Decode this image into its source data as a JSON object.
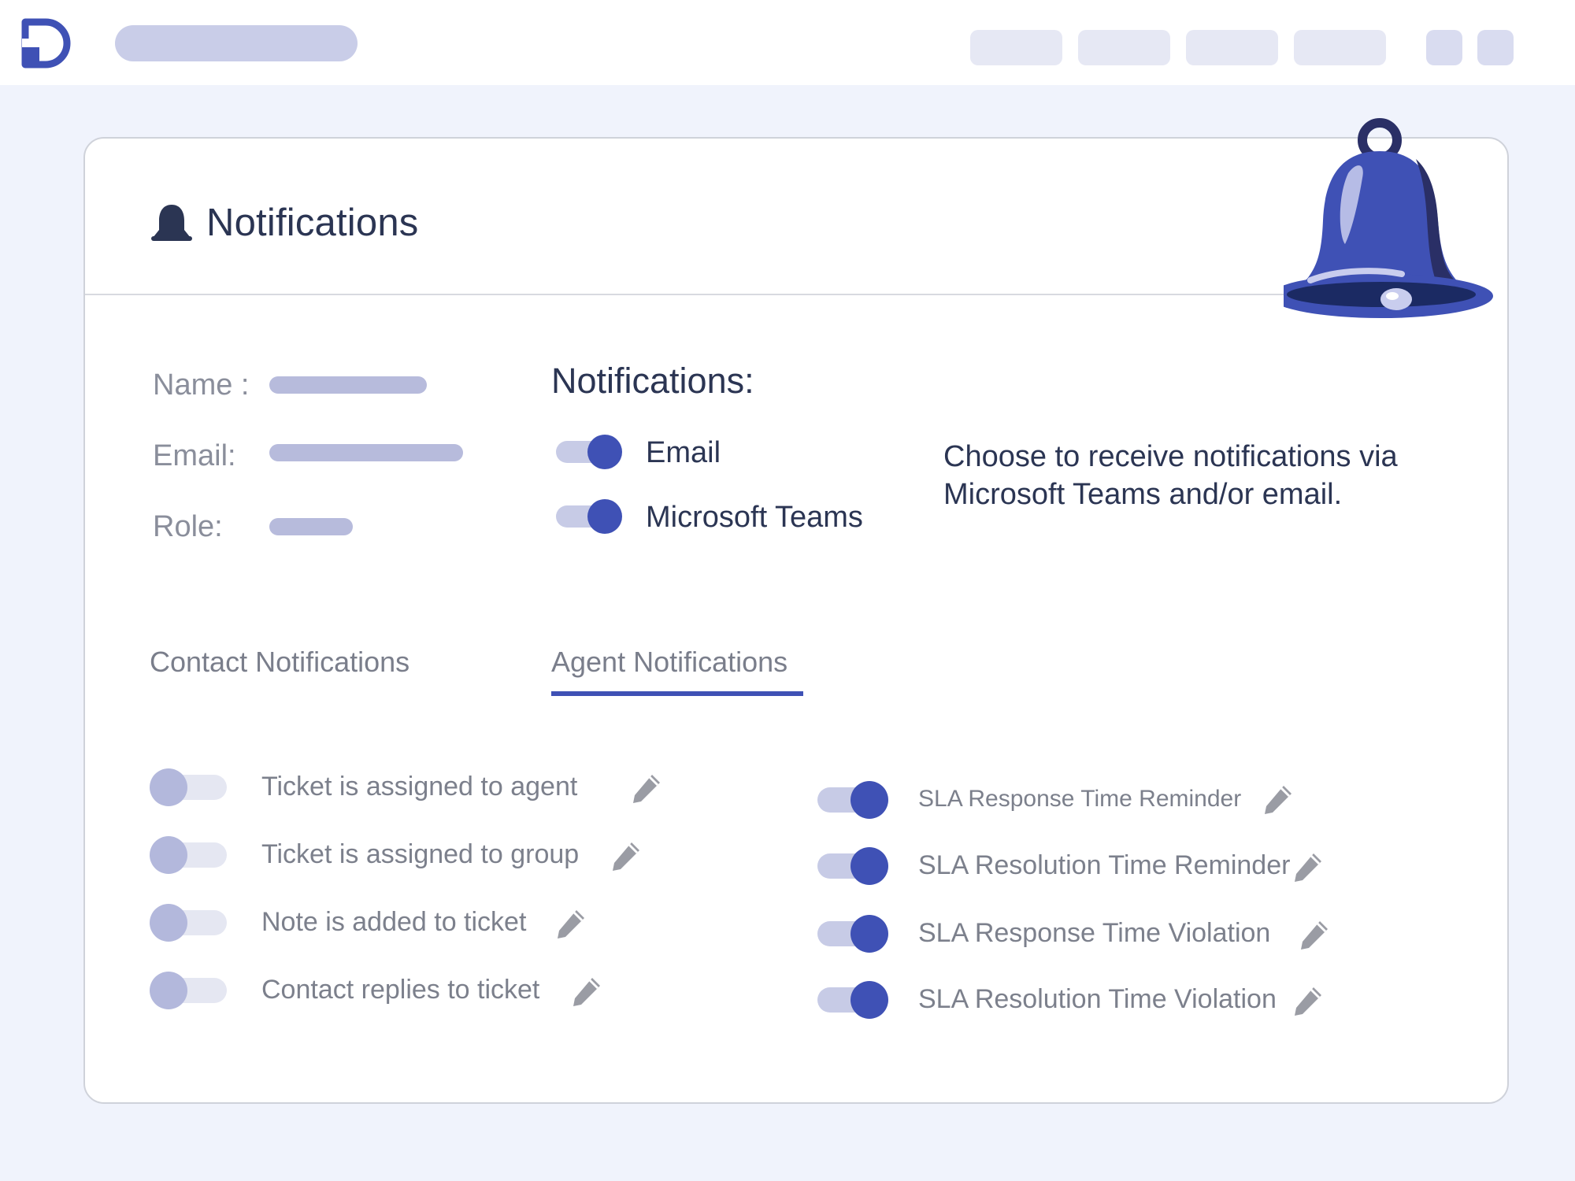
{
  "colors": {
    "accent": "#3f51b5",
    "toggle_on_track": "#c7cbe6",
    "toggle_off_track": "#e5e7f2",
    "toggle_off_knob": "#b3b8dc",
    "text_dark": "#2b3553",
    "text_muted": "#7c808c"
  },
  "card": {
    "title": "Notifications",
    "title_icon": "bell-icon"
  },
  "profile": {
    "name_label": "Name :",
    "email_label": "Email:",
    "role_label": "Role:"
  },
  "channels": {
    "heading": "Notifications:",
    "items": [
      {
        "label": "Email",
        "enabled": true
      },
      {
        "label": "Microsoft Teams",
        "enabled": true
      }
    ],
    "helper_text": "Choose to receive notifications via Microsoft Teams and/or email."
  },
  "tabs": [
    {
      "label": "Contact Notifications",
      "active": false
    },
    {
      "label": "Agent Notifications",
      "active": true
    }
  ],
  "contact_notifications": [
    {
      "label": "Ticket is assigned to agent",
      "enabled": false,
      "icon": "pencil-icon"
    },
    {
      "label": "Ticket is assigned to group",
      "enabled": false,
      "icon": "pencil-icon"
    },
    {
      "label": "Note is added to ticket",
      "enabled": false,
      "icon": "pencil-icon"
    },
    {
      "label": "Contact replies to ticket",
      "enabled": false,
      "icon": "pencil-icon"
    }
  ],
  "agent_notifications": [
    {
      "label": "SLA Response Time Reminder",
      "enabled": true,
      "icon": "pencil-icon"
    },
    {
      "label": "SLA Resolution Time Reminder",
      "enabled": true,
      "icon": "pencil-icon"
    },
    {
      "label": "SLA Response Time Violation",
      "enabled": true,
      "icon": "pencil-icon"
    },
    {
      "label": "SLA Resolution Time Violation",
      "enabled": true,
      "icon": "pencil-icon"
    }
  ]
}
